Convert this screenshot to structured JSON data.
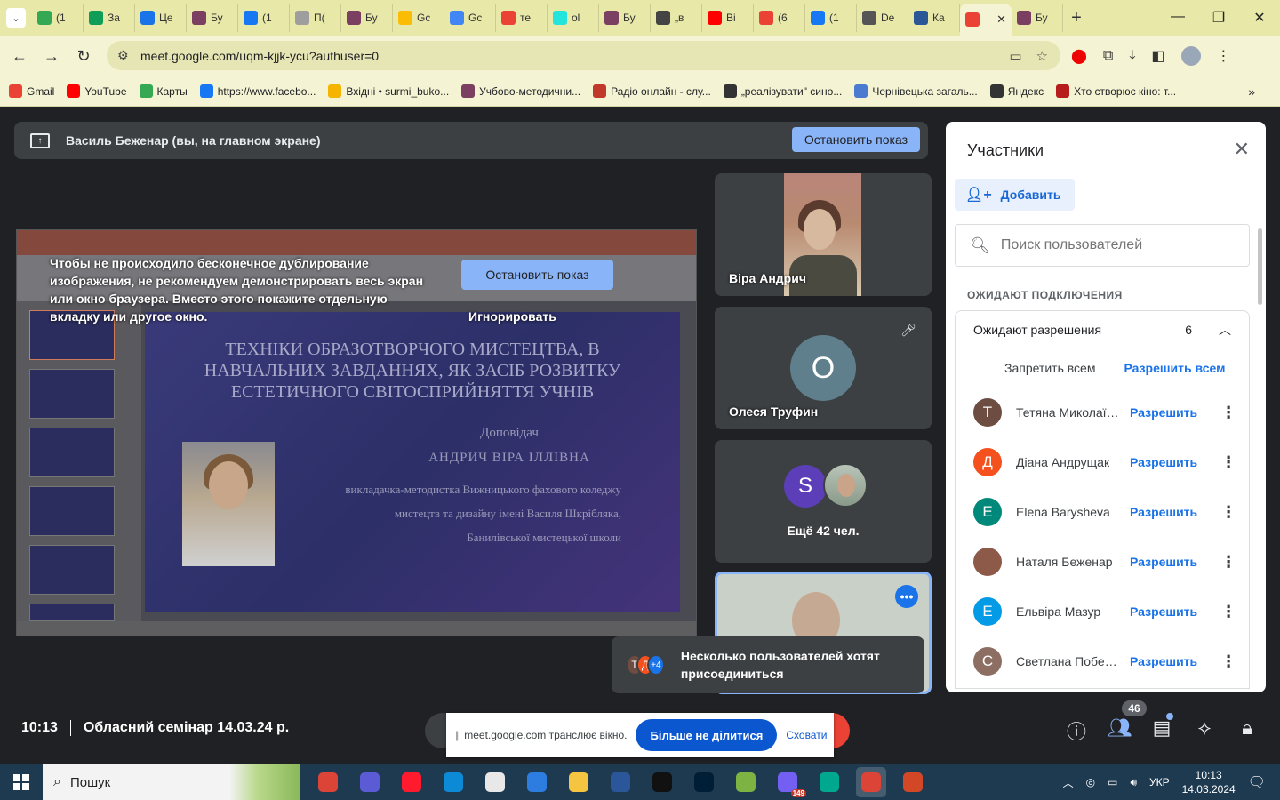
{
  "browser": {
    "tabs": [
      {
        "label": "(1",
        "color": "#34a853"
      },
      {
        "label": "За",
        "color": "#0f9d58"
      },
      {
        "label": "Це",
        "color": "#1a73e8"
      },
      {
        "label": "Бу",
        "color": "#7b3f61"
      },
      {
        "label": "(1",
        "color": "#1877f2"
      },
      {
        "label": "П(",
        "color": "#9e9e9e"
      },
      {
        "label": "Бу",
        "color": "#7b3f61"
      },
      {
        "label": "Gc",
        "color": "#fbbc04"
      },
      {
        "label": "Gc",
        "color": "#4285f4"
      },
      {
        "label": "те",
        "color": "#ea4335"
      },
      {
        "label": "ol",
        "color": "#23e5db"
      },
      {
        "label": "Бу",
        "color": "#7b3f61"
      },
      {
        "label": "„в",
        "color": "#444444"
      },
      {
        "label": "Ві",
        "color": "#ff0000"
      },
      {
        "label": "(6",
        "color": "#ea4335"
      },
      {
        "label": "(1",
        "color": "#1877f2"
      },
      {
        "label": "De",
        "color": "#555555"
      },
      {
        "label": "Ка",
        "color": "#2b5797"
      },
      {
        "label": "",
        "color": "#ea4335",
        "active": true
      },
      {
        "label": "Бу",
        "color": "#7b3f61"
      }
    ],
    "url": "meet.google.com/uqm-kjjk-ycu?authuser=0",
    "bookmarks": [
      {
        "label": "Gmail",
        "color": "#ea4335"
      },
      {
        "label": "YouTube",
        "color": "#ff0000"
      },
      {
        "label": "Карты",
        "color": "#34a853"
      },
      {
        "label": "https://www.facebo...",
        "color": "#1877f2"
      },
      {
        "label": "Вхідні • surmi_buko...",
        "color": "#f4b400"
      },
      {
        "label": "Учбово-методични...",
        "color": "#7b3f61"
      },
      {
        "label": "Радіо онлайн - слу...",
        "color": "#c0392b"
      },
      {
        "label": "„реалізувати\" сино...",
        "color": "#333333"
      },
      {
        "label": "Чернівецька загаль...",
        "color": "#4a7bd0"
      },
      {
        "label": "Яндекс",
        "color": "#333333"
      },
      {
        "label": "Хто створює кіно: т...",
        "color": "#b71c1c"
      }
    ]
  },
  "meet": {
    "present_bar_text": "Василь Беженар (вы, на главном экране)",
    "stop_presenting": "Остановить показ",
    "warning_text": "Чтобы не происходило бесконечное дублирование изображения, не рекомендуем демонстрировать весь экран или окно браузера. Вместо этого покажите отдельную вкладку или другое окно.",
    "stop_presenting_inline": "Остановить показ",
    "ignore": "Игнорировать",
    "slide": {
      "title": "ТЕХНІКИ ОБРАЗОТВОРЧОГО МИСТЕЦТВА, В НАВЧАЛЬНИХ ЗАВДАННЯХ, ЯК ЗАСІБ РОЗВИТКУ ЕСТЕТИЧНОГО СВІТОСПРИЙНЯТТЯ УЧНІВ",
      "speaker_label": "Доповідач",
      "speaker_name": "АНДРИЧ ВІРА ІЛЛІВНА",
      "line1": "викладачка-методистка Вижницького фахового коледжу",
      "line2": "мистецтв та дизайну імені Василя Шкрібляка,",
      "line3": "Банилівської мистецької школи"
    },
    "tiles": {
      "vira": "Віра Андрич",
      "olesia": "Олеся Труфин",
      "olesia_initial": "О",
      "s_initial": "S",
      "more": "Ещё 42 чел."
    },
    "toast": {
      "text": "Несколько пользователей хотят присоединиться",
      "av1": "Т",
      "av2": "Д",
      "av3": "+4"
    },
    "bottom": {
      "time": "10:13",
      "meeting_title": "Обласний семінар 14.03.24 р.",
      "participants_count": "46"
    },
    "sharebar": {
      "text": "meet.google.com транслює вікно.",
      "stop": "Більше не ділитися",
      "hide": "Сховати"
    }
  },
  "panel": {
    "title": "Участники",
    "add": "Добавить",
    "search_placeholder": "Поиск пользователей",
    "section": "ОЖИДАЮТ ПОДКЛЮЧЕНИЯ",
    "group_title": "Ожидают разрешения",
    "group_count": "6",
    "deny_all": "Запретить всем",
    "allow_all": "Разрешить всем",
    "allow": "Разрешить",
    "rows": [
      {
        "initial": "Т",
        "name": "Тетяна Миколаїв...",
        "color": "#6d4c41"
      },
      {
        "initial": "Д",
        "name": "Діана Андрущак",
        "color": "#f4511e"
      },
      {
        "initial": "E",
        "name": "Elena Barysheva",
        "color": "#00897b"
      },
      {
        "initial": "",
        "name": "Наталя Беженар",
        "color": "#8d5a4a"
      },
      {
        "initial": "Е",
        "name": "Ельвіра Мазур",
        "color": "#039be5"
      },
      {
        "initial": "С",
        "name": "Светлана Побер...",
        "color": "#8d6e63"
      }
    ]
  },
  "taskbar": {
    "search": "Пошук",
    "lang": "УКР",
    "time": "10:13",
    "date": "14.03.2024",
    "viber_badge": "149",
    "apps": [
      {
        "name": "chrome",
        "color": "#db4437"
      },
      {
        "name": "app-blue",
        "color": "#5b5bd6"
      },
      {
        "name": "opera",
        "color": "#ff1b2d"
      },
      {
        "name": "edge",
        "color": "#0c8ad6"
      },
      {
        "name": "file",
        "color": "#e8e8e8"
      },
      {
        "name": "notepad",
        "color": "#2d7de0"
      },
      {
        "name": "explorer",
        "color": "#f5c542"
      },
      {
        "name": "word",
        "color": "#2b579a"
      },
      {
        "name": "inkscape",
        "color": "#111111"
      },
      {
        "name": "photoshop",
        "color": "#001e36"
      },
      {
        "name": "app-color",
        "color": "#7cb342"
      },
      {
        "name": "viber",
        "color": "#7360f2"
      },
      {
        "name": "app-teal",
        "color": "#00a88f"
      },
      {
        "name": "chrome-active",
        "color": "#db4437"
      },
      {
        "name": "powerpoint",
        "color": "#d24726"
      }
    ]
  }
}
